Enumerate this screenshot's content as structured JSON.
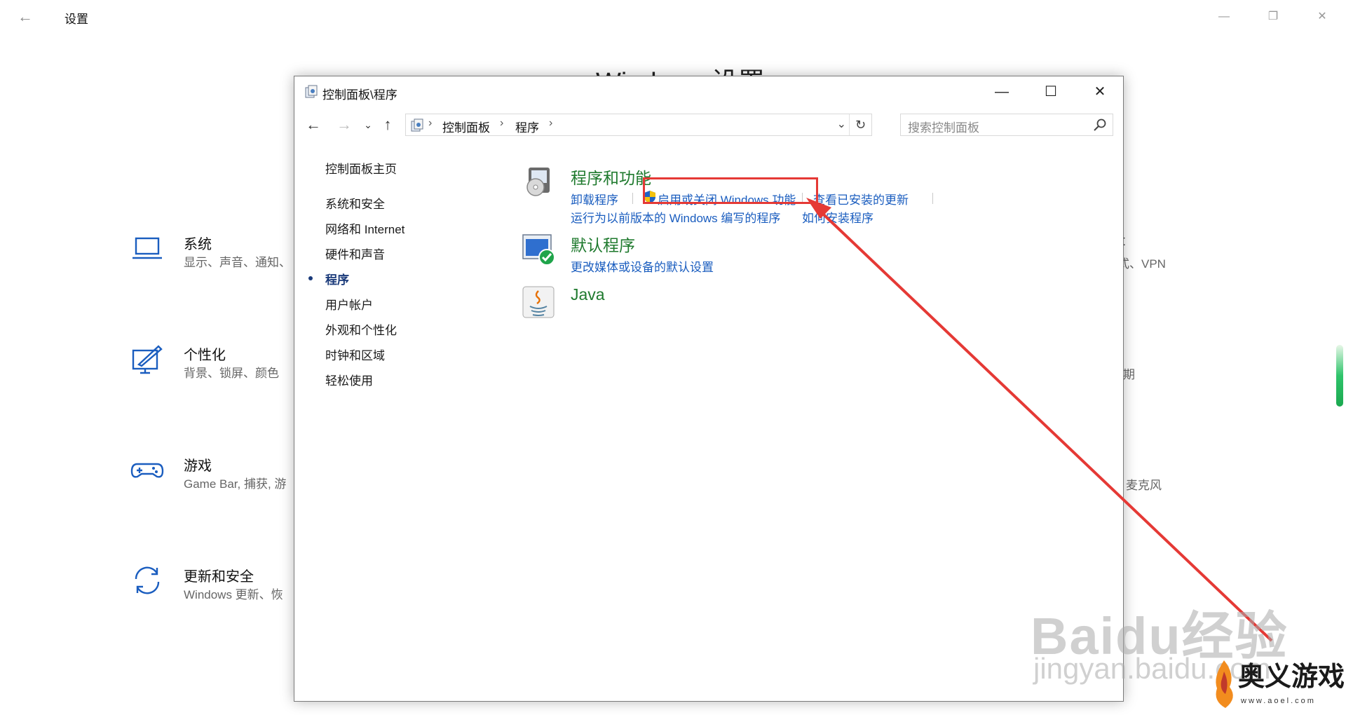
{
  "settings": {
    "title": "设置",
    "heading": "Windows 设置",
    "tiles": [
      {
        "name": "系统",
        "desc": "显示、声音、通知、",
        "icon": "laptop-icon"
      },
      {
        "name": "个性化",
        "desc": "背景、锁屏、颜色",
        "icon": "paint-icon"
      },
      {
        "name": "游戏",
        "desc": "Game Bar, 捕获, 游",
        "icon": "gamepad-icon"
      },
      {
        "name": "更新和安全",
        "desc": "Windows 更新、恢",
        "icon": "update-icon"
      }
    ],
    "right_fragments": [
      "et",
      "式、VPN",
      "期",
      "麦克风"
    ]
  },
  "control_panel": {
    "title": "控制面板\\程序",
    "address": [
      "控制面板",
      "程序"
    ],
    "search_placeholder": "搜索控制面板",
    "sidebar": [
      {
        "label": "控制面板主页"
      },
      {
        "label": "系统和安全"
      },
      {
        "label": "网络和 Internet"
      },
      {
        "label": "硬件和声音"
      },
      {
        "label": "程序",
        "current": true
      },
      {
        "label": "用户帐户"
      },
      {
        "label": "外观和个性化"
      },
      {
        "label": "时钟和区域"
      },
      {
        "label": "轻松使用"
      }
    ],
    "categories": [
      {
        "heading": "程序和功能",
        "icon": "programs-icon",
        "links": [
          "卸载程序",
          "启用或关闭 Windows 功能",
          "查看已安装的更新",
          "运行为以前版本的 Windows 编写的程序",
          "如何安装程序"
        ]
      },
      {
        "heading": "默认程序",
        "icon": "default-programs-icon",
        "links": [
          "更改媒体或设备的默认设置"
        ]
      },
      {
        "heading": "Java",
        "icon": "java-icon",
        "links": []
      }
    ]
  },
  "annotation": {
    "color": "#e53935"
  },
  "watermarks": {
    "baidu": "Baidu经验",
    "baidu_url": "jingyan.baidu.com",
    "brand": "奥义游戏网",
    "brand_url": "www.aoel.com"
  },
  "colors": {
    "link": "#1a5dbf",
    "category": "#1f7a2e",
    "accent": "#1a3a7a"
  }
}
